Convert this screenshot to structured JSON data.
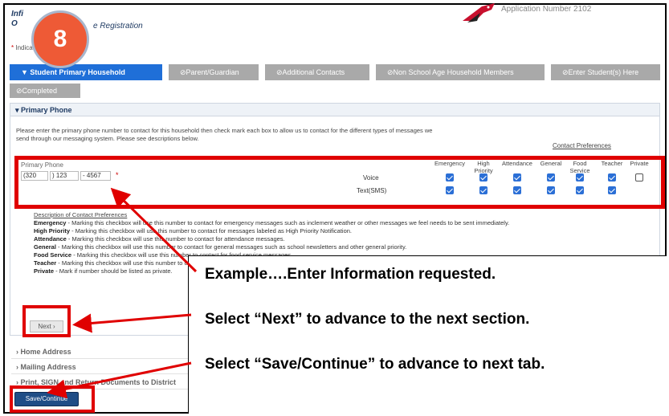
{
  "header": {
    "logo_line1": "Infi",
    "logo_line2": "O",
    "reg_title": "e Registration",
    "app_number": "Application Number 2102",
    "required_note_star": "*",
    "required_note_text": "Indicates a required field"
  },
  "step_badge": "8",
  "tabs": [
    {
      "label": "▼ Student Primary Household",
      "state": "active"
    },
    {
      "label": "⊘Parent/Guardian",
      "state": "inactive"
    },
    {
      "label": "⊘Additional Contacts",
      "state": "inactive"
    },
    {
      "label": "⊘Non School Age Household Members",
      "state": "inactive"
    },
    {
      "label": "⊘Enter Student(s) Here",
      "state": "inactive"
    },
    {
      "label": "⊘Completed",
      "state": "inactive"
    }
  ],
  "primary_phone": {
    "heading": "▾ Primary Phone",
    "instructions": "Please enter the primary phone number to contact for this household then check mark each box to allow us to contact for the different types of messages we send through our messaging system. Please see descriptions below.",
    "field_label": "Primary Phone",
    "area_code": "(320",
    "prefix": ") 123",
    "line": "- 4567",
    "required_star": "*",
    "contact_pref_heading": "Contact Preferences",
    "pref_columns": [
      "Emergency",
      "High Priority",
      "Attendance",
      "General",
      "Food Service",
      "Teacher",
      "Private"
    ],
    "rows": [
      {
        "label": "Voice",
        "checks": [
          true,
          true,
          true,
          true,
          true,
          true,
          false
        ]
      },
      {
        "label": "Text(SMS)",
        "checks": [
          true,
          true,
          true,
          true,
          true,
          true,
          null
        ]
      }
    ]
  },
  "descriptions": {
    "title": "Description of Contact Preferences",
    "items": [
      {
        "term": "Emergency",
        "text": " - Marking this checkbox will use this number to contact for emergency messages such as inclement weather or other messages we feel needs to be sent immediately."
      },
      {
        "term": "High Priority",
        "text": " - Marking this checkbox will use this number to contact for messages labeled as High Priority Notification."
      },
      {
        "term": "Attendance",
        "text": " - Marking this checkbox will use this number to contact for attendance messages."
      },
      {
        "term": "General",
        "text": " - Marking this checkbox will use this number to contact for general messages such as school newsletters and other general priority."
      },
      {
        "term": "Food Service",
        "text": " - Marking this checkbox will use this number to contact for food service messages."
      },
      {
        "term": "Teacher",
        "text": " - Marking this checkbox will use this number to contact for teacher messages."
      },
      {
        "term": "Private",
        "text": " - Mark if number should be listed as private."
      }
    ]
  },
  "next_label": "Next ›",
  "collapsed_sections": [
    "› Home Address",
    "› Mailing Address",
    "› Print, SIGN and Return Documents to District"
  ],
  "save_label": "Save/Continue",
  "callout": {
    "line1": "Example….Enter Information requested.",
    "line2": "Select “Next” to advance to the next section.",
    "line3": "Select “Save/Continue” to advance to next tab."
  },
  "colors": {
    "active_tab": "#1f6fd8",
    "inactive_tab": "#a9a9a9",
    "highlight_red": "#e00000",
    "badge": "#ee5a36",
    "save_button": "#1f4d86"
  }
}
